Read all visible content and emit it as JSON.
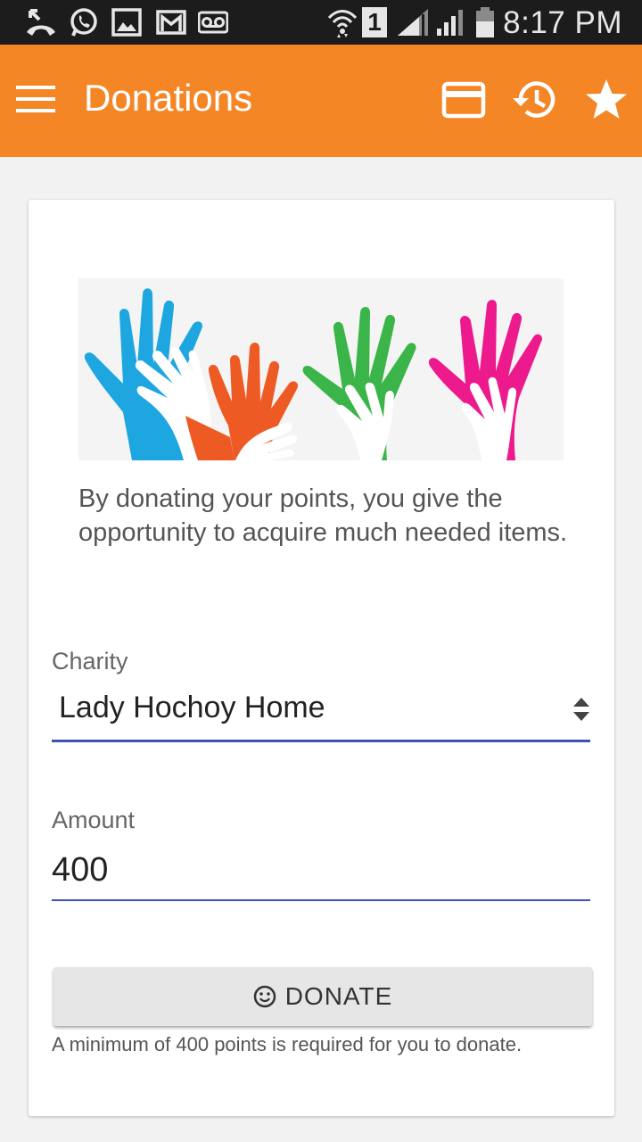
{
  "status_bar": {
    "time": "8:17 PM",
    "icons": [
      "missed-call-icon",
      "whatsapp-icon",
      "gallery-icon",
      "gmail-icon",
      "voicemail-icon",
      "wifi-icon",
      "sim-1-icon",
      "signal-icon",
      "signal-icon",
      "battery-icon"
    ],
    "sim_badge": "1"
  },
  "app_bar": {
    "title": "Donations",
    "color": "#f58626",
    "actions": [
      "card-icon",
      "history-icon",
      "star-icon"
    ]
  },
  "card": {
    "banner_icon": "helping-hands-image",
    "intro_text": "By donating your points, you give the opportunity to acquire much needed items.",
    "charity": {
      "label": "Charity",
      "value": "Lady Hochoy Home"
    },
    "amount": {
      "label": "Amount",
      "value": "400"
    },
    "donate_button": {
      "icon": "smiley-icon",
      "label": "DONATE"
    },
    "hint": "A minimum of 400 points is required for you to donate."
  },
  "colors": {
    "accent": "#3f51b5",
    "hand_blue": "#1ea6e0",
    "hand_orange": "#ee5a24",
    "hand_green": "#3bb54a",
    "hand_pink": "#ec1a8c"
  }
}
